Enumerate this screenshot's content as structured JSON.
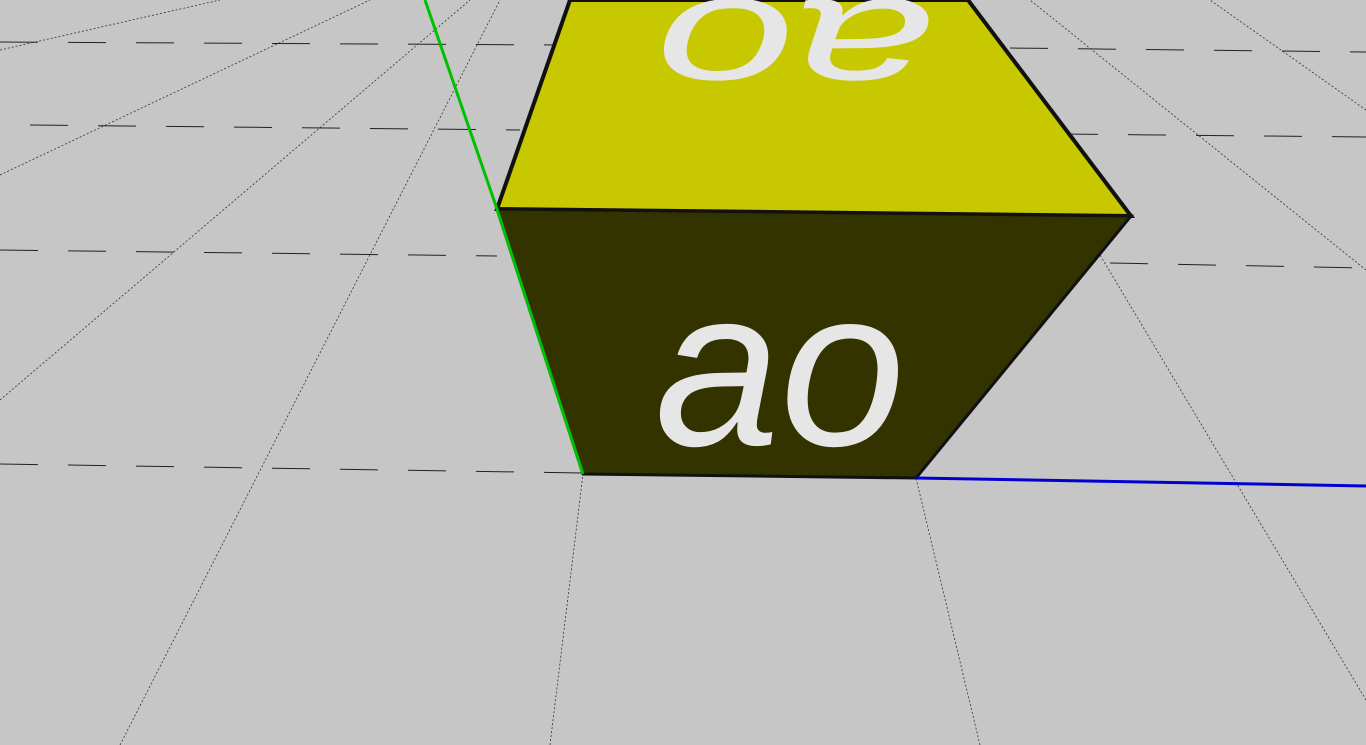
{
  "viewport": {
    "background_color": "#c6c6c6",
    "cube": {
      "top_face_color": "#c8c800",
      "front_face_color": "#333300",
      "edge_color": "#111111",
      "top_face_logo": "ao",
      "front_face_logo": "ao",
      "logo_color": "#e6e6e6"
    },
    "axes": {
      "y_axis_color": "#00c000",
      "z_axis_color": "#0000d0"
    }
  }
}
